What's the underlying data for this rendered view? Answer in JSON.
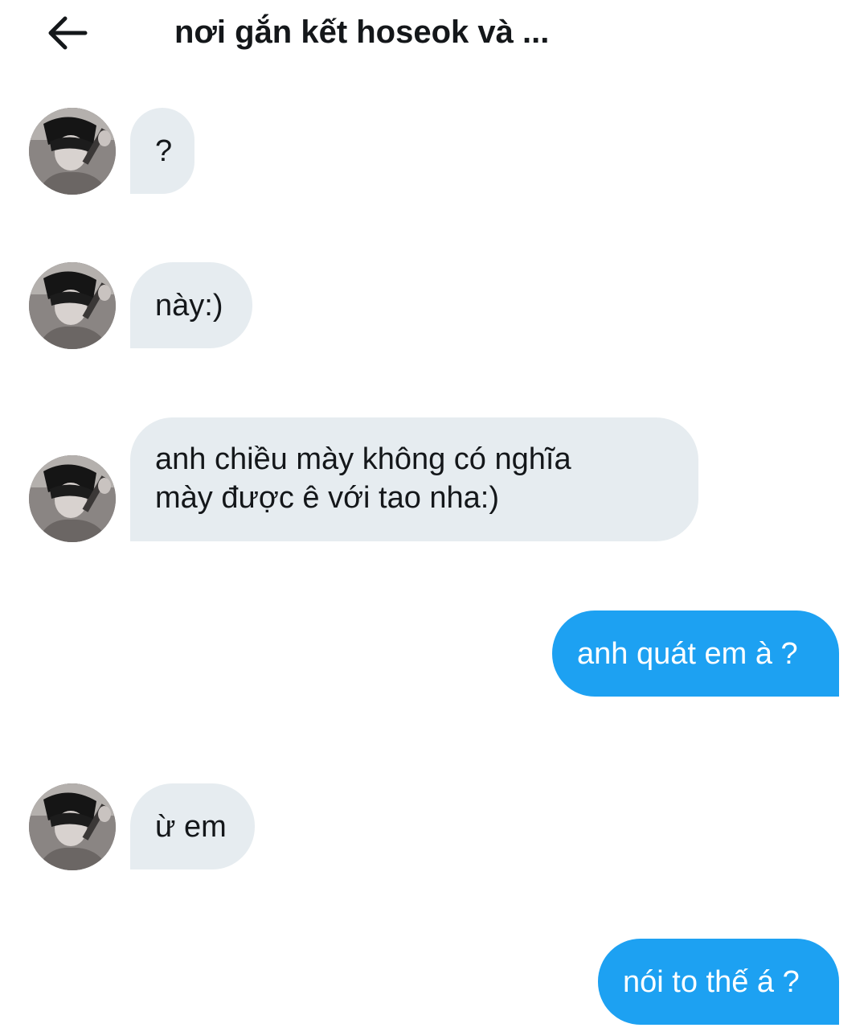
{
  "header": {
    "title": "nơi gắn kết hoseok và ...",
    "back_icon": "arrow-left-icon"
  },
  "colors": {
    "incoming_bubble": "#e6ecf0",
    "outgoing_bubble": "#1da1f2",
    "incoming_text": "#14171a",
    "outgoing_text": "#ffffff"
  },
  "messages": [
    {
      "direction": "incoming",
      "lines": [
        "?"
      ]
    },
    {
      "direction": "incoming",
      "lines": [
        "này:)"
      ]
    },
    {
      "direction": "incoming",
      "lines": [
        "anh chiều mày không có nghĩa",
        "mày được ê với tao nha:)"
      ]
    },
    {
      "direction": "outgoing",
      "lines": [
        "anh quát em à ?"
      ]
    },
    {
      "direction": "incoming",
      "lines": [
        "ừ em"
      ]
    },
    {
      "direction": "outgoing",
      "lines": [
        "nói to thế á ?"
      ]
    }
  ]
}
